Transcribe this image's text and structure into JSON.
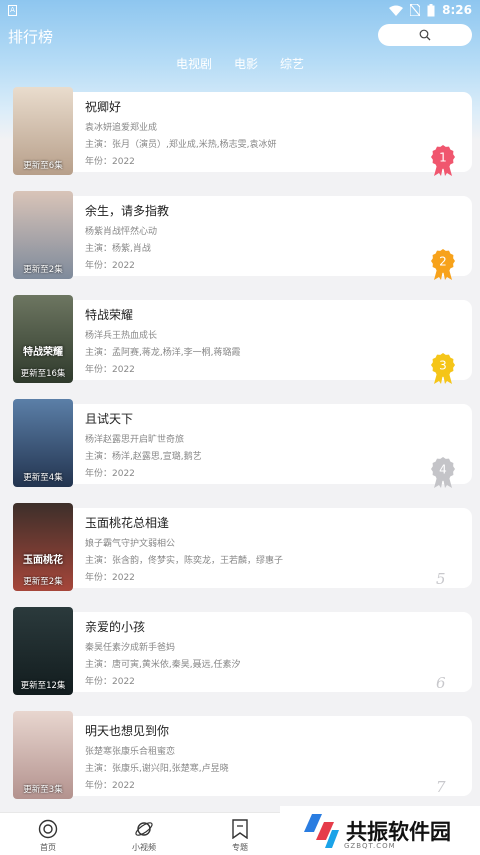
{
  "status_bar": {
    "time": "8:26",
    "left_badge": "A"
  },
  "header": {
    "title": "排行榜",
    "search_icon": "search-icon"
  },
  "tabs": [
    {
      "label": "电视剧"
    },
    {
      "label": "电影"
    },
    {
      "label": "综艺"
    }
  ],
  "items": [
    {
      "title": "祝卿好",
      "desc": "袁冰妍追爱郑业成",
      "cast": "主演：张月（演员）,郑业成,米热,杨志雯,袁冰妍",
      "year": "年份：2022",
      "poster_label": "更新至6集",
      "poster_logo": "",
      "rank": "1",
      "rank_color": "#f0566e"
    },
    {
      "title": "余生，请多指教",
      "desc": "杨紫肖战怦然心动",
      "cast": "主演：杨紫,肖战",
      "year": "年份：2022",
      "poster_label": "更新至2集",
      "poster_logo": "",
      "rank": "2",
      "rank_color": "#f7a21b"
    },
    {
      "title": "特战荣耀",
      "desc": "杨洋兵王热血成长",
      "cast": "主演：孟阿赛,蒋龙,杨洋,李一桐,蒋璐霞",
      "year": "年份：2022",
      "poster_label": "更新至16集",
      "poster_logo": "特战荣耀",
      "rank": "3",
      "rank_color": "#f5c518"
    },
    {
      "title": "且试天下",
      "desc": "杨洋赵露思开启旷世奇旅",
      "cast": "主演：杨洋,赵露思,宣璐,鹅艺",
      "year": "年份：2022",
      "poster_label": "更新至4集",
      "poster_logo": "",
      "rank": "4",
      "rank_color": "#c4c4c8"
    },
    {
      "title": "玉面桃花总相逢",
      "desc": "娘子霸气守护文弱相公",
      "cast": "主演：张含韵，佟梦实，陈奕龙，王若麟，缪惠子",
      "year": "年份：2022",
      "poster_label": "更新至2集",
      "poster_logo": "玉面桃花",
      "rank": "5",
      "rank_color": ""
    },
    {
      "title": "亲爱的小孩",
      "desc": "秦昊任素汐成新手爸妈",
      "cast": "主演：唐可寅,黄米依,秦昊,聂远,任素汐",
      "year": "年份：2022",
      "poster_label": "更新至12集",
      "poster_logo": "",
      "rank": "6",
      "rank_color": ""
    },
    {
      "title": "明天也想见到你",
      "desc": "张楚寒张康乐合租蜜恋",
      "cast": "主演：张康乐,谢兴阳,张楚寒,卢昱晓",
      "year": "年份：2022",
      "poster_label": "更新至3集",
      "poster_logo": "",
      "rank": "7",
      "rank_color": ""
    }
  ],
  "poster_colors": [
    [
      "#e9dccd",
      "#b79f8a"
    ],
    [
      "#d9c4b8",
      "#7e8a9b"
    ],
    [
      "#6d7661",
      "#2f3a2c"
    ],
    [
      "#5b7fa8",
      "#23344f"
    ],
    [
      "#3d2f2a",
      "#a6463a"
    ],
    [
      "#2b3a3c",
      "#121c1e"
    ],
    [
      "#e8d6cf",
      "#b3928e"
    ]
  ],
  "bottom_nav": [
    {
      "label": "首页",
      "icon": "home-icon"
    },
    {
      "label": "小视频",
      "icon": "planet-icon"
    },
    {
      "label": "专题",
      "icon": "bookmark-icon"
    }
  ],
  "watermark": {
    "text": "共振软件园",
    "sub": "GZBQT.COM"
  }
}
